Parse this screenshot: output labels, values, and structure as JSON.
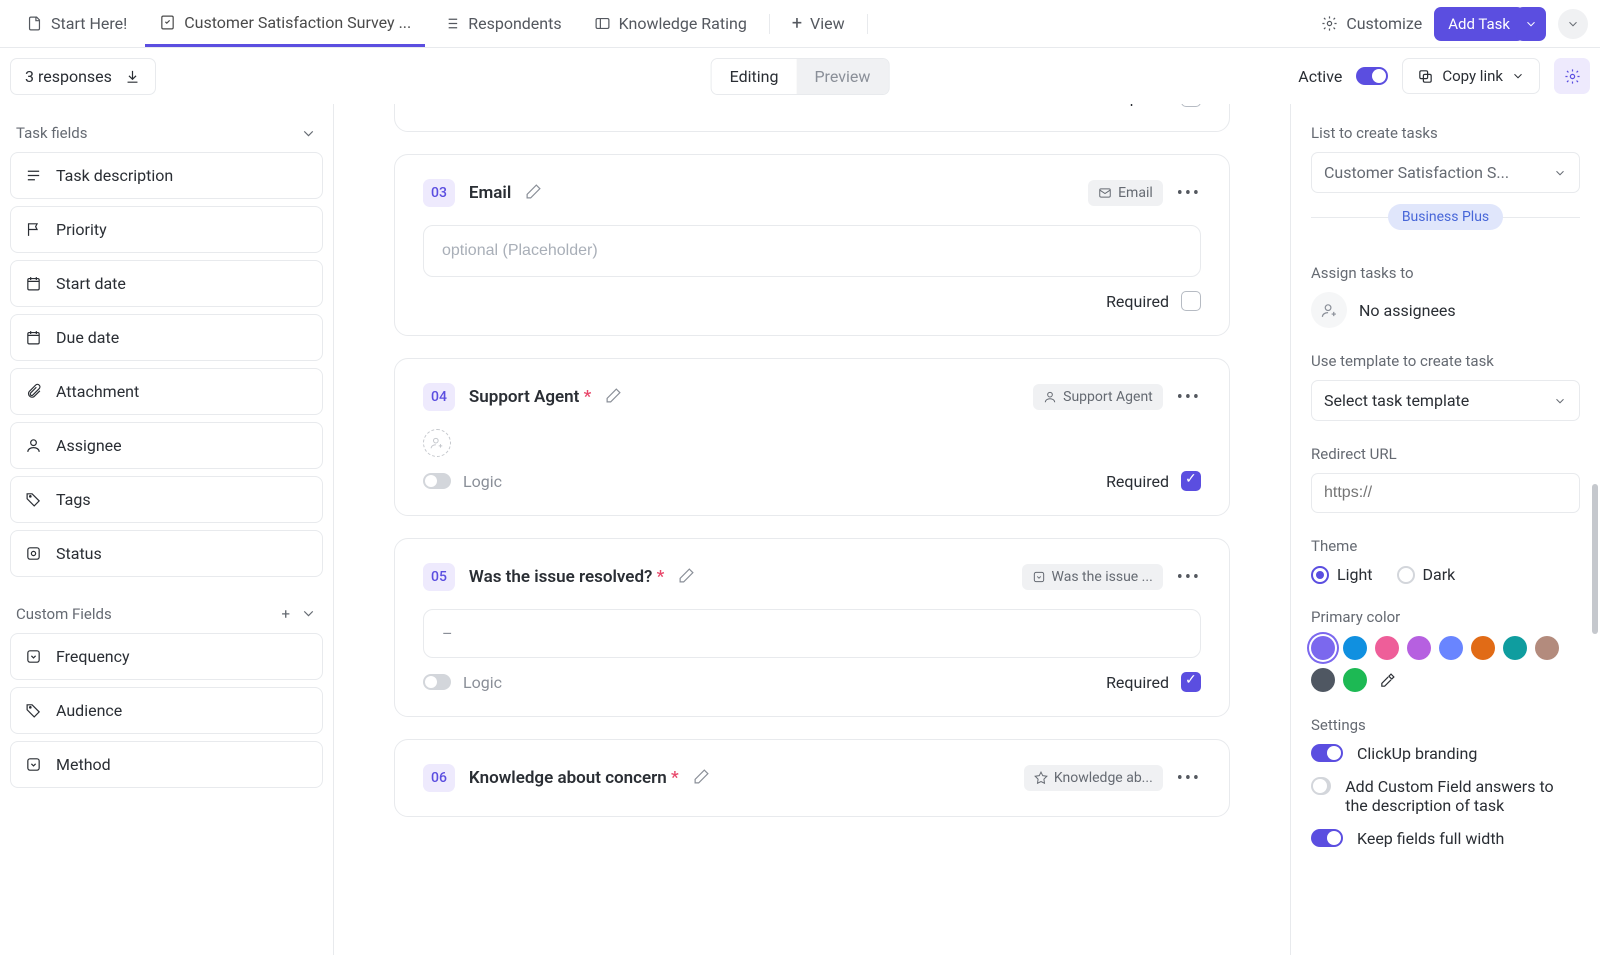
{
  "topnav": {
    "start_here": "Start Here!",
    "current": "Customer Satisfaction Survey ...",
    "respondents": "Respondents",
    "knowledge_rating": "Knowledge Rating",
    "view": "View",
    "customize": "Customize",
    "add_task": "Add Task"
  },
  "subbar": {
    "responses": "3 responses",
    "editing": "Editing",
    "preview": "Preview",
    "active": "Active",
    "copy_link": "Copy link"
  },
  "left": {
    "task_fields": "Task fields",
    "fields": {
      "desc": "Task description",
      "priority": "Priority",
      "start": "Start date",
      "due": "Due date",
      "attachment": "Attachment",
      "assignee": "Assignee",
      "tags": "Tags",
      "status": "Status"
    },
    "custom_fields": "Custom Fields",
    "custom": {
      "frequency": "Frequency",
      "audience": "Audience",
      "method": "Method"
    }
  },
  "center": {
    "required": "Required",
    "logic": "Logic",
    "placeholder": "optional (Placeholder)",
    "cards": {
      "c2": {
        "num": "",
        "title": "",
        "tag": ""
      },
      "c3": {
        "num": "03",
        "title": "Email",
        "tag": "Email"
      },
      "c4": {
        "num": "04",
        "title": "Support Agent",
        "tag": "Support Agent"
      },
      "c5": {
        "num": "05",
        "title": "Was the issue resolved?",
        "tag": "Was the issue ...",
        "dash": "–"
      },
      "c6": {
        "num": "06",
        "title": "Knowledge about concern",
        "tag": "Knowledge ab..."
      }
    }
  },
  "right": {
    "list_label": "List to create tasks",
    "list_value": "Customer Satisfaction S...",
    "biz_plus": "Business Plus",
    "assign_label": "Assign tasks to",
    "no_assignees": "No assignees",
    "template_label": "Use template to create task",
    "template_value": "Select task template",
    "redirect_label": "Redirect URL",
    "redirect_placeholder": "https://",
    "theme_label": "Theme",
    "theme_light": "Light",
    "theme_dark": "Dark",
    "primary_label": "Primary color",
    "settings_label": "Settings",
    "s_branding": "ClickUp branding",
    "s_add_custom": "Add Custom Field answers to the description of task",
    "s_full_width": "Keep fields full width"
  },
  "colors": [
    "#7b68ee",
    "#1090e0",
    "#ee5e99",
    "#b660e0",
    "#6985ff",
    "#e16b16",
    "#0f9d9f",
    "#b38b7d",
    "#4f5762",
    "#1db954"
  ]
}
